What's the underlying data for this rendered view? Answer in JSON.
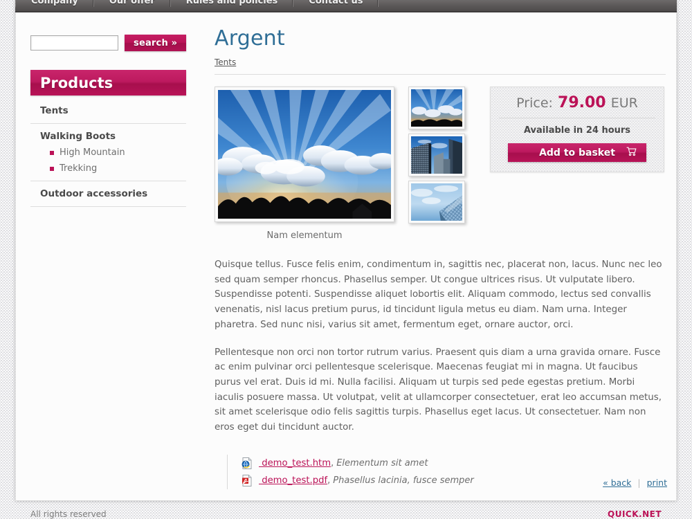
{
  "topnav": {
    "tabs": [
      {
        "label": "Company"
      },
      {
        "label": "Our offer"
      },
      {
        "label": "Rules and policies"
      },
      {
        "label": "Contact us"
      }
    ]
  },
  "sidebar": {
    "search": {
      "value": "",
      "placeholder": "",
      "button_label": "search »"
    },
    "products_header": "Products",
    "categories": [
      {
        "label": "Tents",
        "children": []
      },
      {
        "label": "Walking Boots",
        "children": [
          {
            "label": "High Mountain"
          },
          {
            "label": "Trekking"
          }
        ]
      },
      {
        "label": "Outdoor accessories",
        "children": []
      }
    ]
  },
  "main": {
    "title": "Argent",
    "breadcrumb": "Tents",
    "gallery": {
      "main_caption": "Nam elementum",
      "main_alt": "sunbeams-through-clouds-photo",
      "thumbs": [
        {
          "alt": "sunbeams-through-clouds-thumb"
        },
        {
          "alt": "skyscrapers-thumb"
        },
        {
          "alt": "glass-tower-upward-thumb"
        }
      ]
    },
    "pricebox": {
      "price_label": "Price:",
      "price_amount": "79.00",
      "price_currency": "EUR",
      "availability": "Available in 24 hours",
      "add_to_basket_label": "Add to basket",
      "cart_icon": "shopping-cart-icon"
    },
    "paragraphs": [
      "Quisque tellus. Fusce felis enim, condimentum in, sagittis nec, placerat non, lacus. Nunc nec leo sed quam semper rhoncus. Phasellus semper. Ut congue ultrices risus. Ut vulputate libero. Suspendisse potenti. Suspendisse aliquet lobortis elit. Aliquam commodo, lectus sed convallis venenatis, nisl lacus pretium purus, id tincidunt ligula metus eu diam. Nam urna. Integer pharetra. Sed nunc nisi, varius sit amet, fermentum eget, ornare auctor, orci.",
      "Pellentesque non orci non tortor rutrum varius. Praesent quis diam a urna gravida ornare. Fusce ac enim pulvinar orci pellentesque scelerisque. Maecenas feugiat mi in magna. Ut faucibus purus vel erat. Duis id mi. Nulla facilisi. Aliquam ut turpis sed pede egestas pretium. Morbi iaculis posuere massa. Ut volutpat, velit at ullamcorper consectetuer, erat leo accumsan metus, sit amet scelerisque odio felis sagittis turpis. Phasellus eget lacus. Ut consectetuer. Nam non eros eget dui tincidunt auctor."
    ],
    "attachments": [
      {
        "icon": "html-file-icon",
        "link": " demo_test.htm",
        "comma": ",",
        "desc": "Elementum sit amet"
      },
      {
        "icon": "pdf-file-icon",
        "link": " demo_test.pdf",
        "comma": ",",
        "desc": "Phasellus lacinia, fusce semper"
      }
    ]
  },
  "footer": {
    "back_label": "« back",
    "separator": "|",
    "print_label": "print",
    "below_left": "All rights reserved",
    "below_right": "QUICK.NET"
  },
  "colors": {
    "accent": "#bb1257",
    "title_blue": "#2f6e96",
    "nav_bar": "#5a5757",
    "text": "#5f5f5f"
  }
}
